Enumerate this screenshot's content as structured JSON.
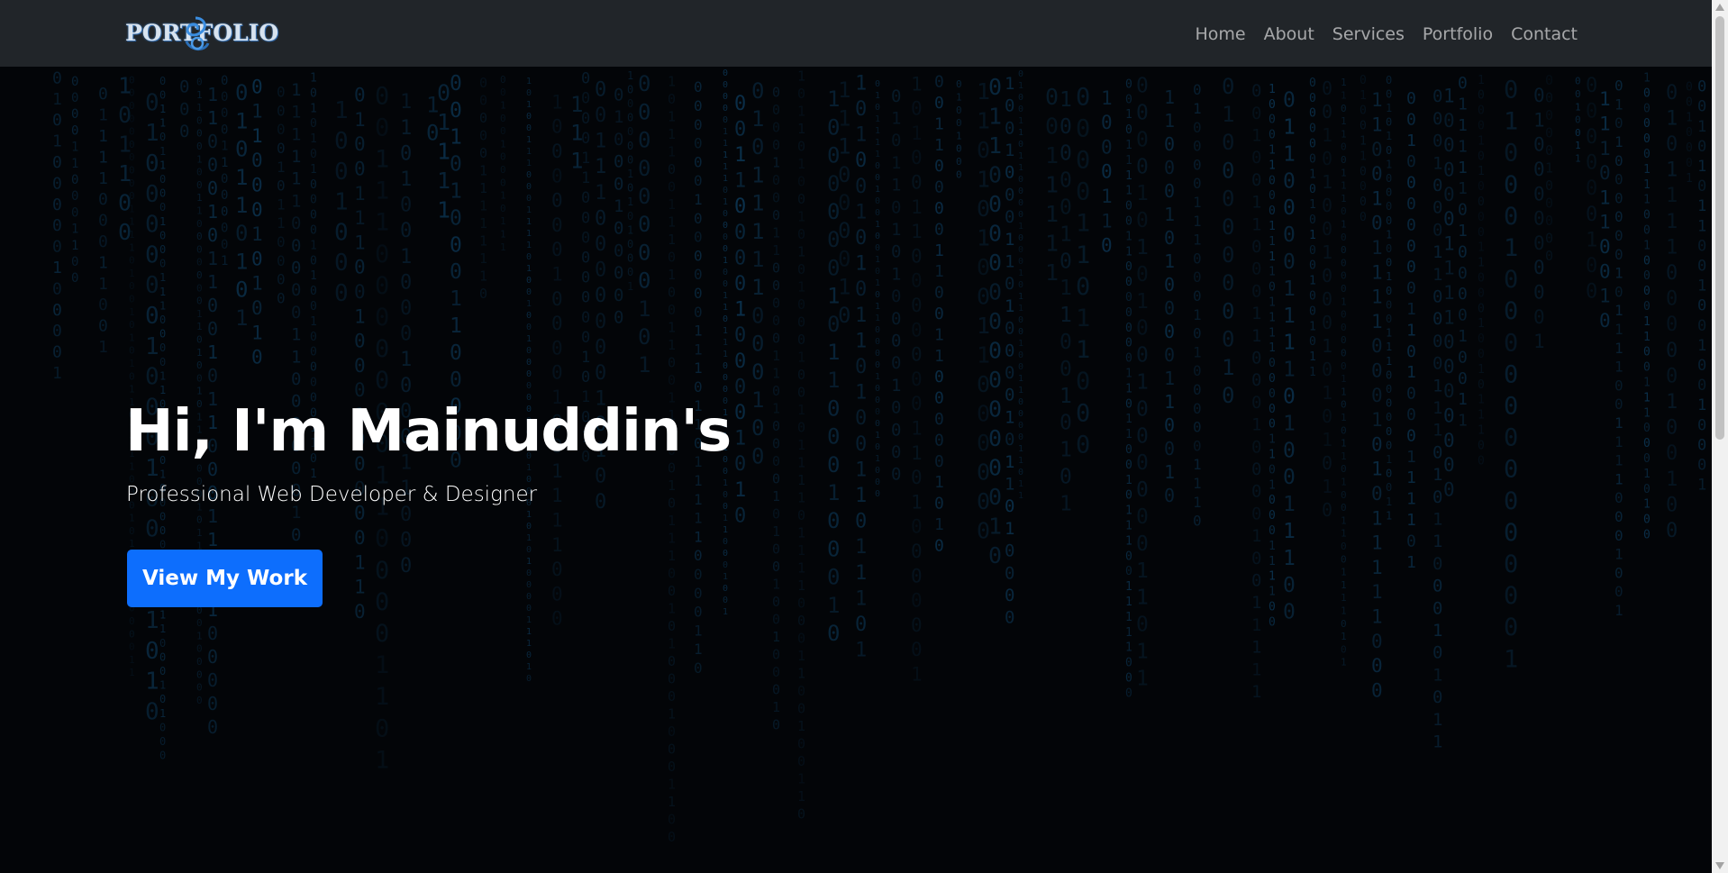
{
  "navbar": {
    "logo_text": "PORTFOLIO",
    "links": [
      {
        "label": "Home"
      },
      {
        "label": "About"
      },
      {
        "label": "Services"
      },
      {
        "label": "Portfolio"
      },
      {
        "label": "Contact"
      }
    ]
  },
  "hero": {
    "title": "Hi, I'm Mainuddin's",
    "subtitle": "Professional Web Developer & Designer",
    "button_label": "View My Work",
    "background_effect": "binary-matrix-rain",
    "glyphs": [
      "0",
      "1"
    ]
  },
  "colors": {
    "navbar_bg": "#212529",
    "hero_bg": "#030508",
    "accent": "#0d6efd",
    "matrix_glyph": "#0d3b5c"
  }
}
